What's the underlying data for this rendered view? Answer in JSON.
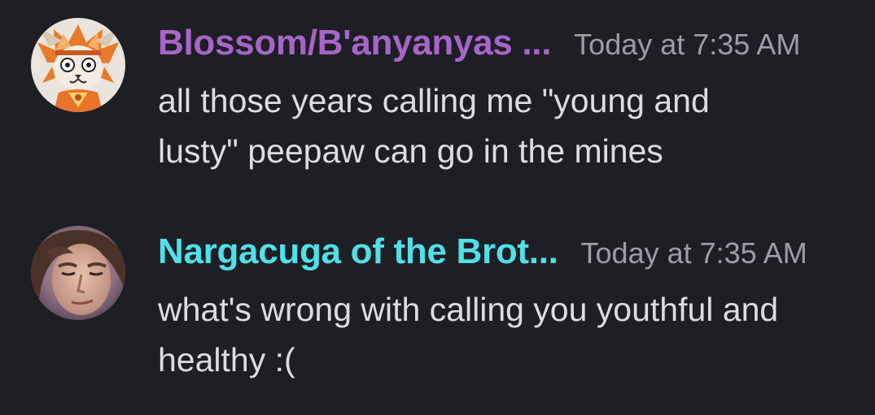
{
  "messages": [
    {
      "author": "Blossom/B'anyanyas ...",
      "author_color": "#a765c9",
      "timestamp": "Today at 7:35 AM",
      "lines": [
        "all those years calling me \"young and",
        "lusty\" peepaw can go in the mines"
      ],
      "avatar_icon": "orange-cat-character-avatar"
    },
    {
      "author": "Nargacuga of the Brot...",
      "author_color": "#4fe0e8",
      "timestamp": "Today at 7:35 AM",
      "lines": [
        "what's wrong with calling you youthful and",
        "healthy :("
      ],
      "avatar_icon": "person-face-avatar"
    }
  ]
}
